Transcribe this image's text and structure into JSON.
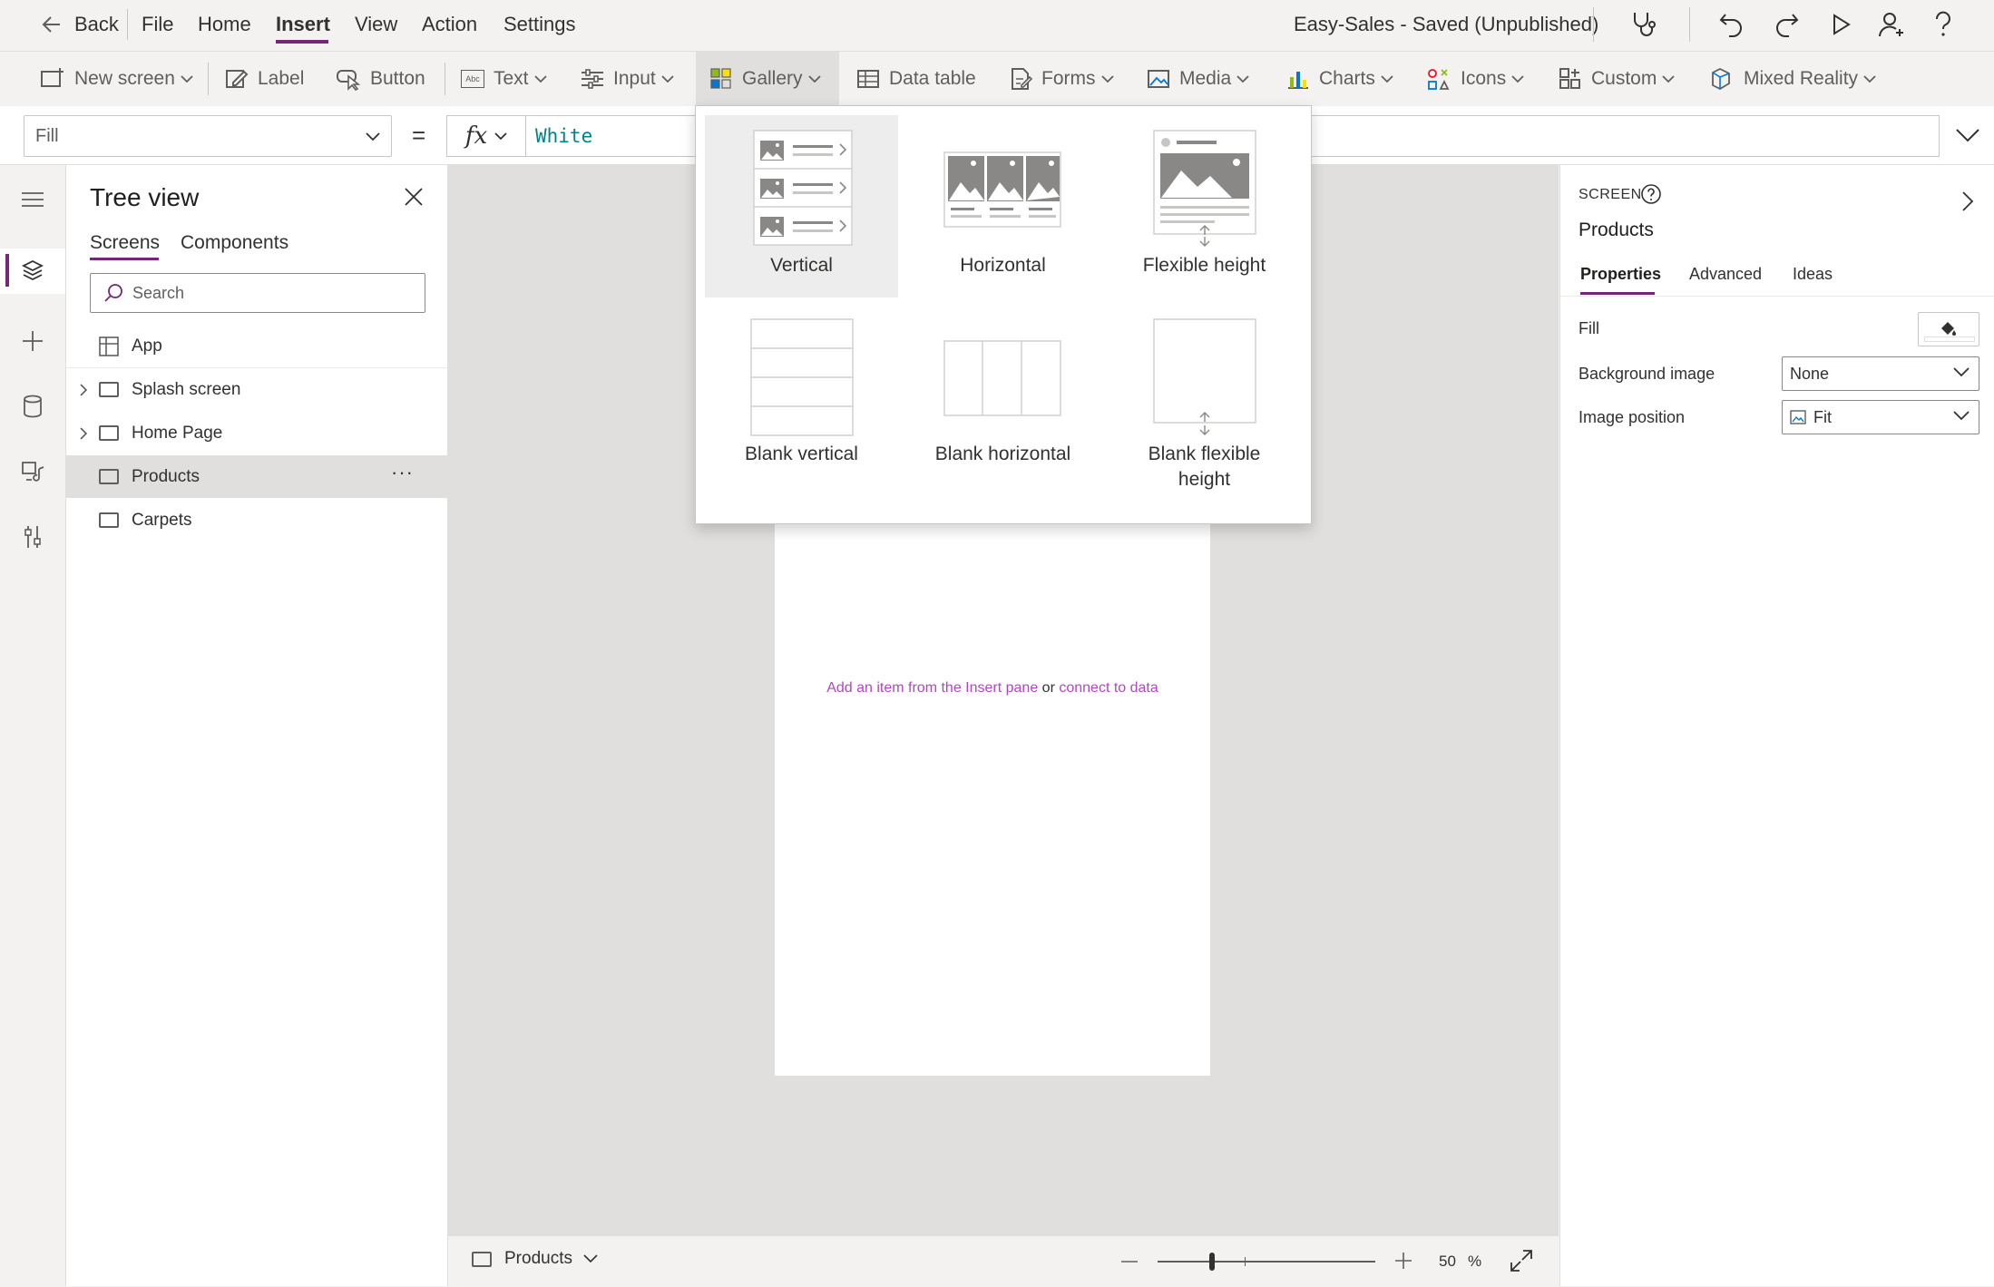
{
  "menubar": {
    "back_label": "Back",
    "items": [
      "File",
      "Home",
      "Insert",
      "View",
      "Action",
      "Settings"
    ],
    "active_item": "Insert",
    "app_status": "Easy-Sales - Saved (Unpublished)"
  },
  "ribbon": {
    "new_screen": "New screen",
    "label": "Label",
    "button": "Button",
    "text": "Text",
    "input": "Input",
    "gallery": "Gallery",
    "data_table": "Data table",
    "forms": "Forms",
    "media": "Media",
    "charts": "Charts",
    "icons": "Icons",
    "custom": "Custom",
    "mixed_reality": "Mixed Reality",
    "text_icon_glyph": "Abc"
  },
  "formula_bar": {
    "property": "Fill",
    "equals": "=",
    "fx": "fx",
    "value": "White"
  },
  "tree_view": {
    "title": "Tree view",
    "tabs": [
      "Screens",
      "Components"
    ],
    "active_tab": "Screens",
    "search_placeholder": "Search",
    "app_label": "App",
    "items": [
      {
        "label": "Splash screen",
        "expandable": true
      },
      {
        "label": "Home Page",
        "expandable": true
      },
      {
        "label": "Products",
        "expandable": false,
        "selected": true
      },
      {
        "label": "Carpets",
        "expandable": false
      }
    ],
    "more_label": "···"
  },
  "canvas": {
    "hint_link1": "Add an item from the Insert pane",
    "hint_or": "or",
    "hint_link2": "connect to data"
  },
  "bottom_bar": {
    "screen": "Products",
    "zoom_value": "50",
    "zoom_unit": "%",
    "zoom_level": 0.25
  },
  "properties_panel": {
    "type_label": "SCREEN",
    "screen_name": "Products",
    "tabs": [
      "Properties",
      "Advanced",
      "Ideas"
    ],
    "active_tab": "Properties",
    "fill_label": "Fill",
    "background_image_label": "Background image",
    "background_image_value": "None",
    "image_position_label": "Image position",
    "image_position_value": "Fit"
  },
  "gallery_menu": {
    "options": [
      {
        "label": "Vertical",
        "selected": true
      },
      {
        "label": "Horizontal"
      },
      {
        "label": "Flexible height"
      },
      {
        "label": "Blank vertical"
      },
      {
        "label": "Blank horizontal"
      },
      {
        "label": "Blank flexible height"
      }
    ]
  },
  "colors": {
    "accent": "#742774",
    "link": "#b146c2",
    "formula_value": "#038387"
  }
}
